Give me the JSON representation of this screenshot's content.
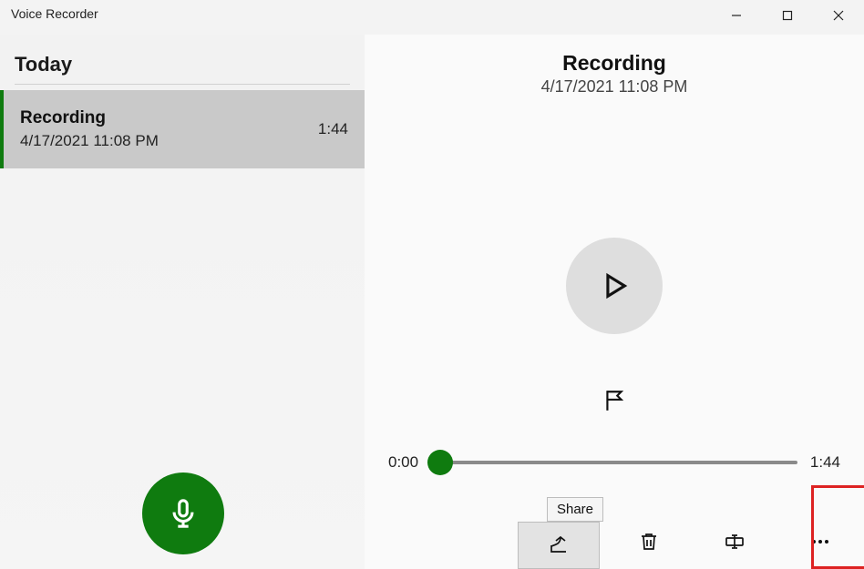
{
  "window": {
    "title": "Voice Recorder"
  },
  "sidebar": {
    "section_header": "Today",
    "items": [
      {
        "title": "Recording",
        "date": "4/17/2021 11:08 PM",
        "duration": "1:44"
      }
    ]
  },
  "main": {
    "title": "Recording",
    "subtitle": "4/17/2021 11:08 PM",
    "start_time": "0:00",
    "end_time": "1:44"
  },
  "toolbar": {
    "share_tooltip": "Share"
  },
  "colors": {
    "accent": "#0f7b0f"
  }
}
